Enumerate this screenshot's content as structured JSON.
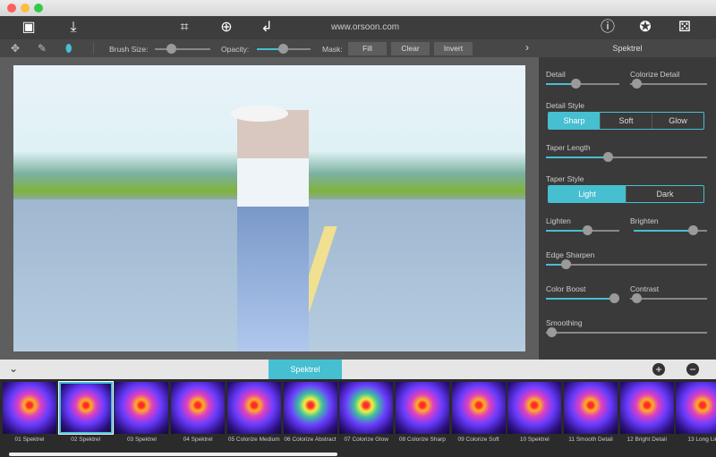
{
  "toolbar": {
    "icons": [
      "image-icon",
      "save-icon",
      "crop-icon",
      "zoom-icon",
      "undo-icon",
      "info-icon",
      "settings-icon",
      "dice-icon"
    ],
    "watermark": "www.orsoon.com"
  },
  "subbar": {
    "brush_size_label": "Brush Size:",
    "brush_size": 0.35,
    "opacity_label": "Opacity:",
    "opacity": 0.5,
    "mask_label": "Mask:",
    "fill": "Fill",
    "clear": "Clear",
    "invert": "Invert"
  },
  "panel": {
    "title": "Spektrel",
    "detail": "Detail",
    "detail_value": 0.3,
    "colorize_detail": "Colorize Detail",
    "colorize_detail_value": 0.05,
    "detail_style": "Detail Style",
    "detail_style_options": [
      "Sharp",
      "Soft",
      "Glow"
    ],
    "detail_style_selected": "Sharp",
    "taper_length": "Taper Length",
    "taper_length_value": 0.38,
    "taper_style": "Taper Style",
    "taper_style_options": [
      "Light",
      "Dark"
    ],
    "taper_style_selected": "Light",
    "lighten": "Lighten",
    "lighten_value": 0.55,
    "brighten": "Brighten",
    "brighten_value": 0.9,
    "edge_sharpen": "Edge Sharpen",
    "edge_sharpen_value": 0.12,
    "color_boost": "Color Boost",
    "color_boost_value": 0.95,
    "contrast": "Contrast",
    "contrast_value": 0.05,
    "smoothing": "Smoothing",
    "smoothing_value": 0.03
  },
  "bottom": {
    "tab": "Spektrel"
  },
  "presets": [
    "01 Spektrel",
    "02 Spektrel",
    "03 Spektrel",
    "04 Spektrel",
    "05 Colorize Medium",
    "06 Colorize Abstract",
    "07 Colorize Glow",
    "08 Colorize Sharp",
    "09 Colorize Soft",
    "10 Spektrel",
    "11 Smooth Detail",
    "12 Bright Detail",
    "13 Long Lin"
  ],
  "selected_preset": "02 Spektrel",
  "colors": {
    "accent": "#46bfd1"
  }
}
